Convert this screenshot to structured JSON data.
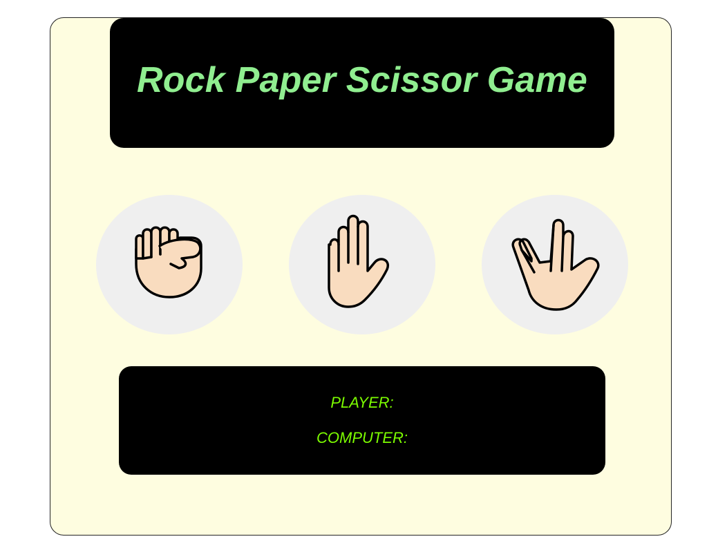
{
  "title": "Rock Paper Scissor Game",
  "choices": [
    {
      "id": "rock",
      "icon": "raised-fist-icon"
    },
    {
      "id": "paper",
      "icon": "raised-hand-icon"
    },
    {
      "id": "scissor",
      "icon": "vulcan-salute-icon"
    }
  ],
  "score": {
    "player_label": "PLAYER:",
    "player_value": "",
    "computer_label": "COMPUTER:",
    "computer_value": ""
  },
  "colors": {
    "card_background": "#fefde0",
    "panel_background": "#000000",
    "title_text": "#90ee90",
    "score_text": "#7cfc00",
    "choice_circle": "#efefef",
    "skin": "#f9dcbf",
    "outline": "#000000"
  }
}
